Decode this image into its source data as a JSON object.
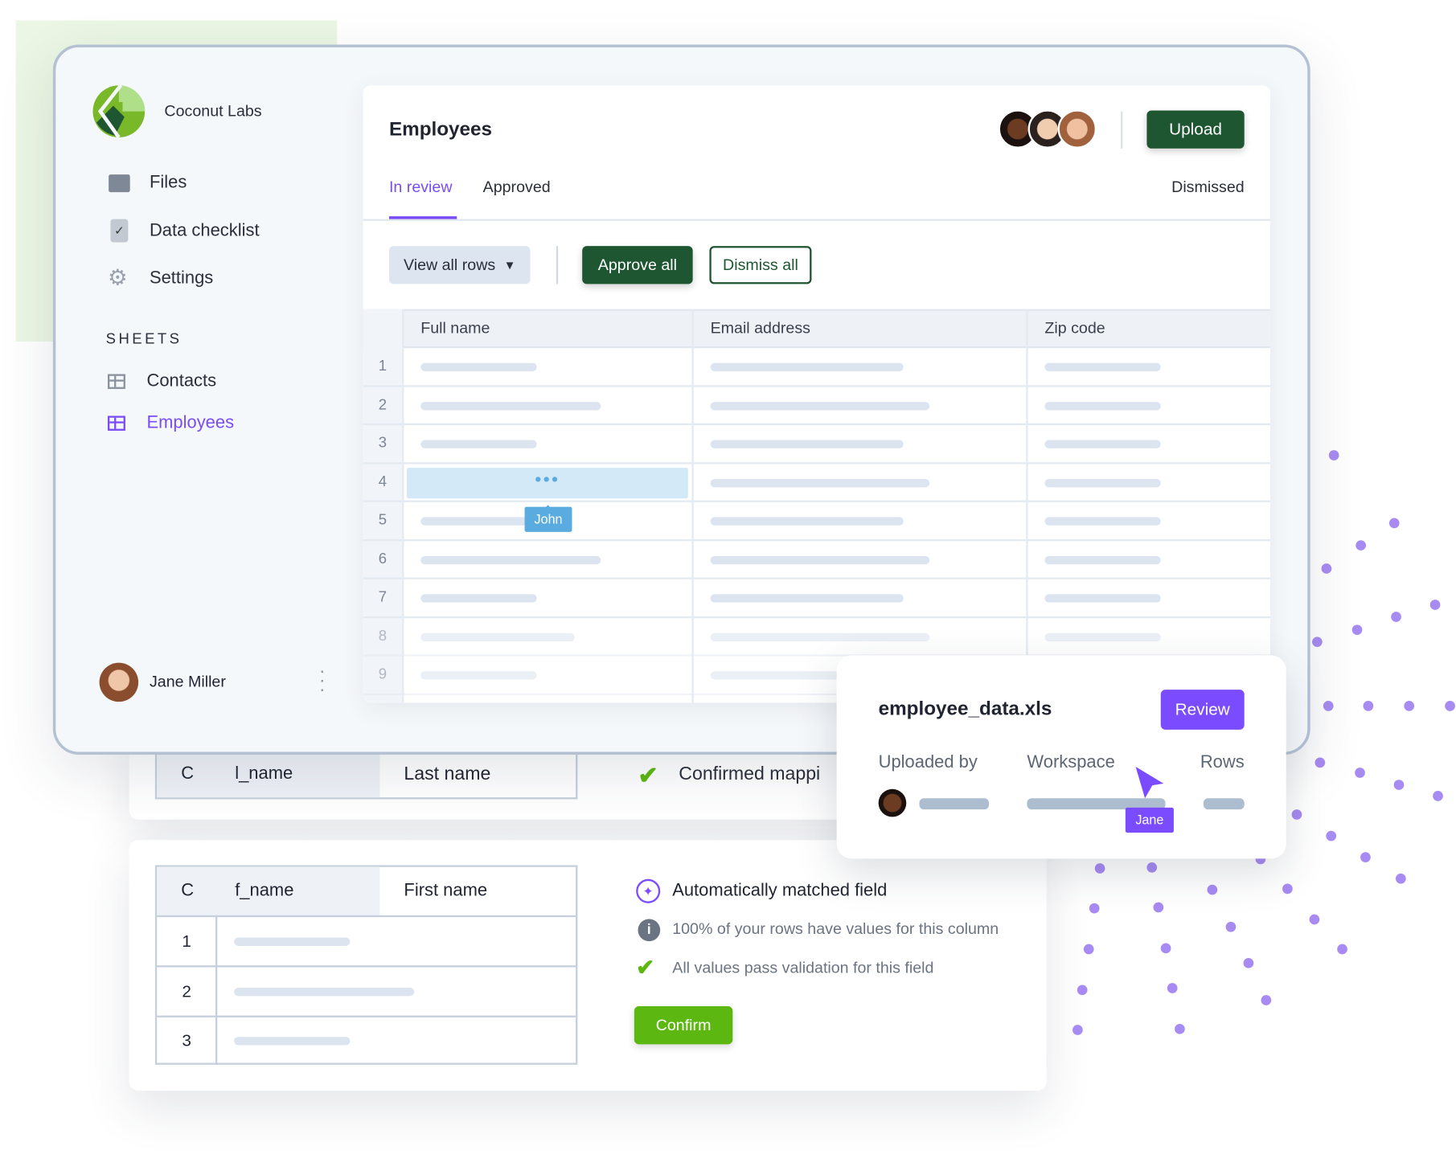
{
  "brand": {
    "name": "Coconut Labs"
  },
  "sidebar": {
    "items": [
      {
        "label": "Files",
        "icon": "folder-icon"
      },
      {
        "label": "Data checklist",
        "icon": "clipboard-check-icon"
      },
      {
        "label": "Settings",
        "icon": "gear-icon"
      }
    ],
    "section_title": "SHEETS",
    "sheets": [
      {
        "label": "Contacts",
        "active": false
      },
      {
        "label": "Employees",
        "active": true
      }
    ],
    "user": {
      "name": "Jane Miller"
    }
  },
  "main": {
    "title": "Employees",
    "upload_label": "Upload",
    "tabs": [
      {
        "label": "In review",
        "active": true
      },
      {
        "label": "Approved"
      },
      {
        "label": "Dismissed"
      }
    ],
    "toolbar": {
      "view_label": "View all rows",
      "approve_label": "Approve all",
      "dismiss_label": "Dismiss all"
    },
    "table": {
      "columns": [
        "Full name",
        "Email address",
        "Zip code"
      ],
      "rows": [
        "1",
        "2",
        "3",
        "4",
        "5",
        "6",
        "7",
        "8",
        "9"
      ],
      "cursor_label": "John"
    }
  },
  "mapping": {
    "row1": {
      "col": "C",
      "source": "l_name",
      "target": "Last name",
      "status": "Confirmed mappi"
    },
    "row2": {
      "col": "C",
      "source": "f_name",
      "target": "First name",
      "rows": [
        "1",
        "2",
        "3"
      ],
      "title": "Automatically matched field",
      "info": "100% of your rows have values for this column",
      "validation": "All values pass validation for this field",
      "confirm_label": "Confirm"
    }
  },
  "popup": {
    "file": "employee_data.xls",
    "review_label": "Review",
    "labels": [
      "Uploaded by",
      "Workspace",
      "Rows"
    ],
    "cursor_label": "Jane"
  },
  "colors": {
    "accent": "#7b4cff",
    "dark_green": "#1e5631",
    "bright_green": "#5cb811",
    "cursor_blue": "#5aace0"
  }
}
